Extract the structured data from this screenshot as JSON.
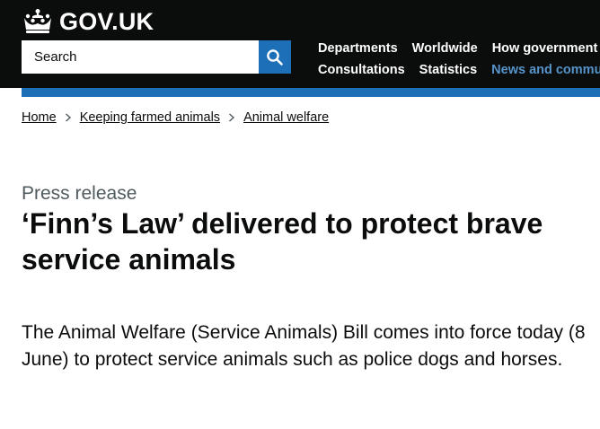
{
  "header": {
    "logo_text": "GOV.UK",
    "search": {
      "placeholder": "Search"
    },
    "nav_rows": [
      [
        {
          "label": "Departments",
          "active": false
        },
        {
          "label": "Worldwide",
          "active": false
        },
        {
          "label": "How government works",
          "active": false
        }
      ],
      [
        {
          "label": "Consultations",
          "active": false
        },
        {
          "label": "Statistics",
          "active": false
        },
        {
          "label": "News and communications",
          "active": true
        }
      ]
    ]
  },
  "breadcrumbs": [
    "Home",
    "Keeping farmed animals",
    "Animal welfare"
  ],
  "article": {
    "doc_type": "Press release",
    "title": "‘Finn’s Law’ delivered to protect brave service animals",
    "lede": "The Animal Welfare (Service Animals) Bill comes into force today (8 June) to protect service animals such as police dogs and horses."
  },
  "colors": {
    "header_bg": "#0b0c0c",
    "accent_blue": "#1d70b8",
    "active_link": "#5694ca",
    "secondary_text": "#505a5f"
  }
}
